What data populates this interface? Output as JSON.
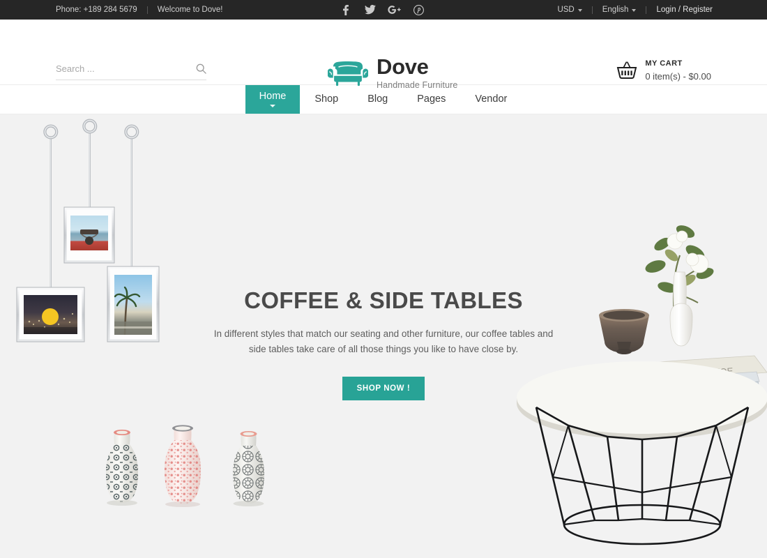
{
  "topbar": {
    "phone": "Phone: +189 284 5679",
    "welcome": "Welcome to Dove!",
    "socials": [
      {
        "name": "facebook-icon",
        "label": "f"
      },
      {
        "name": "twitter-icon",
        "label": "t"
      },
      {
        "name": "google-plus-icon",
        "label": "G+"
      },
      {
        "name": "pinterest-icon",
        "label": "P"
      }
    ],
    "currency": "USD",
    "language": "English",
    "account": "Login / Register"
  },
  "header": {
    "search_placeholder": "Search ...",
    "search_value": "",
    "search_icon": "search-icon",
    "logo_name": "Dove",
    "logo_tagline": "Handmade Furniture",
    "logo_icon": "sofa-icon",
    "cart_icon": "basket-icon",
    "cart_title": "MY CART",
    "cart_summary": "0 item(s) - $0.00"
  },
  "nav": {
    "items": [
      {
        "label": "Home",
        "active": true,
        "has_dropdown": true
      },
      {
        "label": "Shop",
        "active": false,
        "has_dropdown": false
      },
      {
        "label": "Blog",
        "active": false,
        "has_dropdown": false
      },
      {
        "label": "Pages",
        "active": false,
        "has_dropdown": false
      },
      {
        "label": "Vendor",
        "active": false,
        "has_dropdown": false
      }
    ]
  },
  "hero": {
    "title": "COFFEE & SIDE TABLES",
    "description": "In different styles that match our seating and other furniture, our coffee tables and side tables take care of all those things you like to have close by.",
    "cta_label": "SHOP NOW !",
    "background_color": "#f2f2f2",
    "imagery": [
      "hanging-picture-frames",
      "patterned-ceramic-vases",
      "round-coffee-table-styled"
    ]
  },
  "colors": {
    "accent": "#2ba69a",
    "cta": "#28a396",
    "topbar_bg": "#262626",
    "hero_bg": "#f2f2f2",
    "heading": "#4a4a4a"
  }
}
